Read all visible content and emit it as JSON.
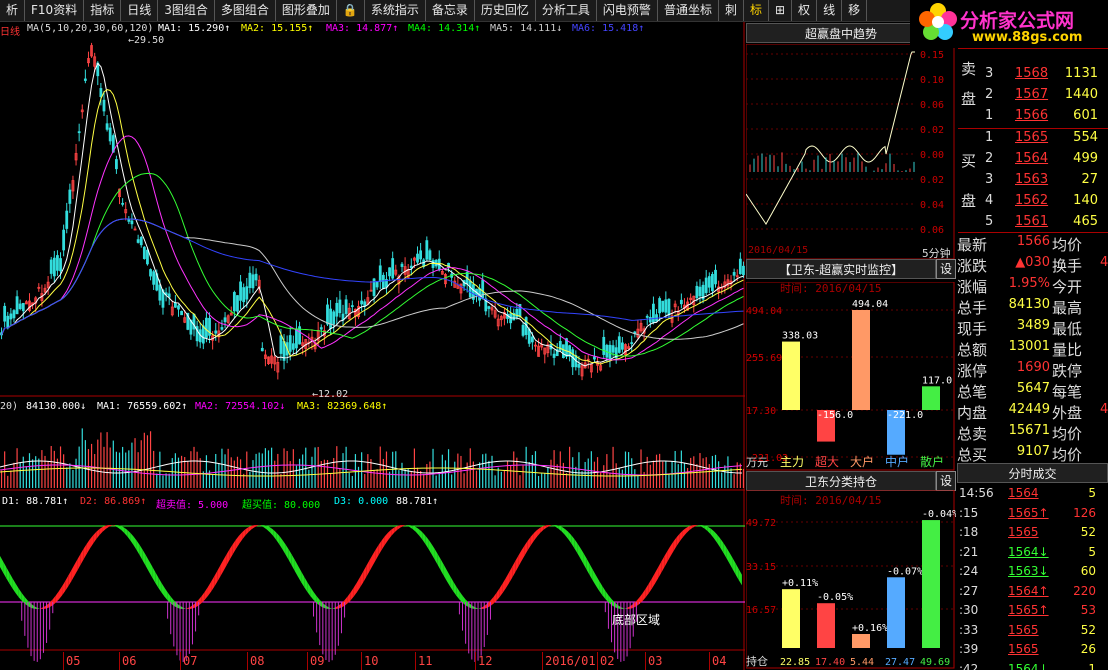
{
  "toolbar": [
    "析",
    "F10资料",
    "指标",
    "日线",
    "3图组合",
    "多图组合",
    "图形叠加",
    "🔒",
    "系统指示",
    "备忘录",
    "历史回忆",
    "分析工具",
    "闪电预警",
    "普通坐标",
    "刺",
    "标",
    "⊞",
    "权",
    "线",
    "移"
  ],
  "active_tool": "标",
  "logo": {
    "title": "分析家公式网",
    "url": "www.88gs.com"
  },
  "ma": {
    "daily": "日线",
    "params": "MA(5,10,20,30,60,120)",
    "ma1": "MA1: 15.290↑",
    "ma2": "MA2: 15.155↑",
    "ma3": "MA3: 14.877↑",
    "ma4": "MA4: 14.314↑",
    "ma5": "MA5: 14.111↓",
    "ma6": "MA6: 15.418↑"
  },
  "price_labels": {
    "high": "←29.50",
    "low": "←12.02"
  },
  "vol": {
    "p": "20)",
    "vol": "84130.000↓",
    "ma1": "MA1: 76559.602↑",
    "ma2": "MA2: 72554.102↓",
    "ma3": "MA3: 82369.648↑"
  },
  "ind": {
    "d1": "D1: 88.781↑",
    "d2": "D2: 86.869↑",
    "over_sell": "超卖值: 5.000",
    "over_buy": "超买值: 80.000",
    "d3": "D3: 0.000",
    "d4": "88.781↑",
    "zone": "底部区域"
  },
  "months": [
    "05",
    "06",
    "07",
    "08",
    "09",
    "10",
    "11",
    "12",
    "2016/01",
    "02",
    "03",
    "04"
  ],
  "trend": {
    "title": "超赢盘中趋势",
    "date": "2016/04/15",
    "unit": "5分钟",
    "ticks": [
      "0.15",
      "0.10",
      "0.06",
      "0.02",
      "0.00",
      "0.02",
      "0.04",
      "0.06"
    ]
  },
  "monitor": {
    "title": "【卫东-超赢实时监控】",
    "button": "设",
    "date_label": "时间: 2016/04/15",
    "ticks": [
      "494.04",
      "255.69",
      "17.30",
      "-221.02"
    ],
    "bars": [
      {
        "name": "主力",
        "value": 338.03,
        "label": "338.03",
        "color": "#ffff66"
      },
      {
        "name": "超大",
        "value": -156.0,
        "label": "-156.0",
        "color": "#ff4444"
      },
      {
        "name": "大户",
        "value": 494.04,
        "label": "494.04",
        "color": "#ff9966"
      },
      {
        "name": "中户",
        "value": -221.0,
        "label": "-221.0",
        "color": "#55aaff"
      },
      {
        "name": "散户",
        "value": 117.0,
        "label": "117.0",
        "color": "#44ee44"
      }
    ],
    "unit": "万元"
  },
  "holding": {
    "title": "卫东分类持仓",
    "button": "设",
    "date_label": "时间: 2016/04/15",
    "ticks": [
      "49.72",
      "33.15",
      "16.57"
    ],
    "bars": [
      {
        "value": 22.85,
        "pct": "+0.11%",
        "color": "#ffff66"
      },
      {
        "value": 17.4,
        "pct": "-0.05%",
        "color": "#ff4444"
      },
      {
        "value": 5.44,
        "pct": "+0.16%",
        "color": "#ff9966"
      },
      {
        "value": 27.47,
        "pct": "-0.07%",
        "color": "#55aaff"
      },
      {
        "value": 49.69,
        "pct": "-0.04%",
        "color": "#44ee44"
      }
    ],
    "values_text": [
      "22.85",
      "17.40",
      "5.44",
      "27.47",
      "49.69"
    ],
    "unit": "持仓"
  },
  "orderbook": {
    "sell_label": [
      "卖",
      "盘"
    ],
    "buy_label": [
      "买",
      "盘"
    ],
    "sells": [
      [
        "3",
        "1568",
        "1131"
      ],
      [
        "2",
        "1567",
        "1440"
      ],
      [
        "1",
        "1566",
        "601"
      ]
    ],
    "buys": [
      [
        "1",
        "1565",
        "554"
      ],
      [
        "2",
        "1564",
        "499"
      ],
      [
        "3",
        "1563",
        "27"
      ],
      [
        "4",
        "1562",
        "140"
      ],
      [
        "5",
        "1561",
        "465"
      ]
    ]
  },
  "quote": [
    [
      "最新",
      "1566",
      "均价",
      ""
    ],
    [
      "涨跌",
      "▲030",
      "换手",
      "4"
    ],
    [
      "涨幅",
      "1.95%",
      "今开",
      ""
    ],
    [
      "总手",
      "84130",
      "最高",
      ""
    ],
    [
      "现手",
      "3489",
      "最低",
      ""
    ],
    [
      "总额",
      "13001",
      "量比",
      ""
    ],
    [
      "涨停",
      "1690",
      "跌停",
      ""
    ],
    [
      "总笔",
      "5647",
      "每笔",
      ""
    ],
    [
      "内盘",
      "42449",
      "外盘",
      "4"
    ],
    [
      "总卖",
      "15671",
      "均价",
      ""
    ],
    [
      "总买",
      "9107",
      "均价",
      ""
    ]
  ],
  "ticks_title": "分时成交",
  "ticks": [
    [
      "14:56",
      "1564",
      "5",
      ""
    ],
    [
      ":15",
      "1565↑",
      "126",
      ""
    ],
    [
      ":18",
      "1565",
      "52",
      ""
    ],
    [
      ":21",
      "1564↓",
      "5",
      ""
    ],
    [
      ":24",
      "1563↓",
      "60",
      ""
    ],
    [
      ":27",
      "1564↑",
      "220",
      ""
    ],
    [
      ":30",
      "1565↑",
      "53",
      ""
    ],
    [
      ":33",
      "1565",
      "52",
      ""
    ],
    [
      ":39",
      "1565",
      "26",
      ""
    ],
    [
      ":42",
      "1564↓",
      "1",
      ""
    ]
  ]
}
